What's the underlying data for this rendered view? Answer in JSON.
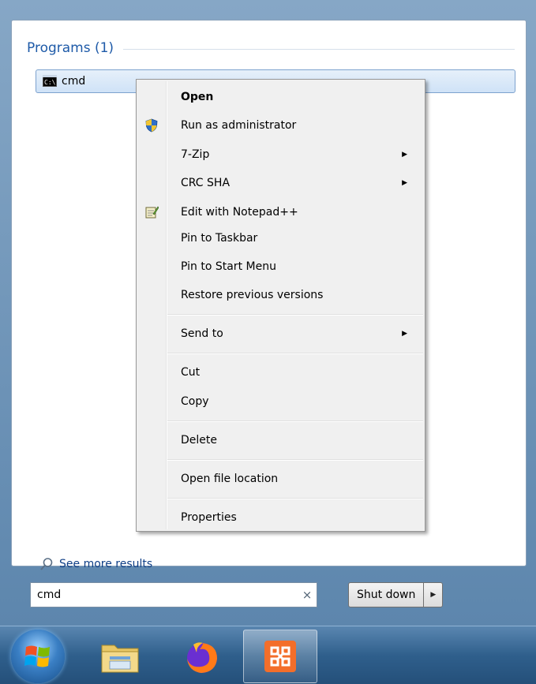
{
  "start_menu": {
    "section_header": "Programs (1)",
    "program_item": {
      "label": "cmd",
      "icon": "cmd-console-icon"
    },
    "see_more": "See more results",
    "search": {
      "value": "cmd",
      "clear_glyph": "×"
    },
    "shutdown": {
      "label": "Shut down",
      "arrow_glyph": "▶"
    }
  },
  "context_menu": {
    "items": [
      {
        "label": "Open",
        "default": true
      },
      {
        "label": "Run as administrator",
        "icon": "uac-shield-icon"
      },
      {
        "label": "7-Zip",
        "submenu": true
      },
      {
        "label": "CRC SHA",
        "submenu": true
      },
      {
        "label": "Edit with Notepad++",
        "icon": "notepad-plus-plus-icon"
      },
      {
        "label": "Pin to Taskbar"
      },
      {
        "label": "Pin to Start Menu"
      },
      {
        "label": "Restore previous versions"
      },
      {
        "label": "Send to",
        "submenu": true
      },
      {
        "label": "Cut"
      },
      {
        "label": "Copy"
      },
      {
        "label": "Delete"
      },
      {
        "label": "Open file location"
      },
      {
        "label": "Properties"
      }
    ],
    "submenu_glyph": "▶"
  },
  "taskbar": {
    "items": [
      {
        "icon": "windows-start-orb-icon"
      },
      {
        "icon": "file-explorer-icon"
      },
      {
        "icon": "firefox-icon"
      },
      {
        "icon": "xampp-icon",
        "active": true
      }
    ]
  },
  "colors": {
    "header_text": "#1e5aa8",
    "link_text": "#0f3f86",
    "selection_border": "#7da2ce",
    "menu_background": "#f0f0f0",
    "taskbar": "#2f5f8c"
  }
}
